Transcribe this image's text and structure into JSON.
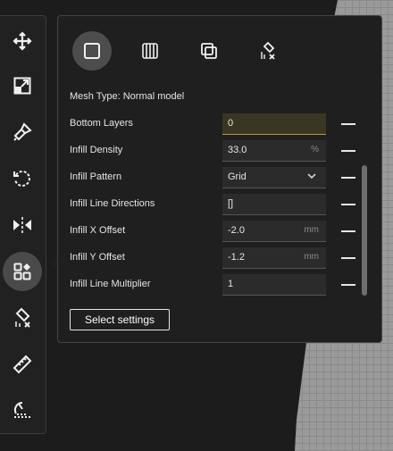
{
  "panel": {
    "mesh_type_label": "Mesh Type: Normal model",
    "mesh_modes": [
      {
        "icon": "normal-model-square-icon",
        "selected": true
      },
      {
        "icon": "support-blocker-lines-icon",
        "selected": false
      },
      {
        "icon": "overlap-squares-icon",
        "selected": false
      },
      {
        "icon": "infill-mesh-modify-icon",
        "selected": false
      }
    ],
    "settings": [
      {
        "label": "Bottom Layers",
        "value": "0",
        "unit": "",
        "type": "text",
        "highlighted": true
      },
      {
        "label": "Infill Density",
        "value": "33.0",
        "unit": "%",
        "type": "text",
        "highlighted": false
      },
      {
        "label": "Infill Pattern",
        "value": "Grid",
        "unit": "",
        "type": "dropdown",
        "highlighted": false
      },
      {
        "label": "Infill Line Directions",
        "value": "[]",
        "unit": "",
        "type": "text",
        "highlighted": false
      },
      {
        "label": "Infill X Offset",
        "value": "-2.0",
        "unit": "mm",
        "type": "text",
        "highlighted": false
      },
      {
        "label": "Infill Y Offset",
        "value": "-1.2",
        "unit": "mm",
        "type": "text",
        "highlighted": false
      },
      {
        "label": "Infill Line Multiplier",
        "value": "1",
        "unit": "",
        "type": "text",
        "highlighted": false
      }
    ],
    "select_settings_label": "Select settings"
  },
  "toolbar": {
    "tools": [
      {
        "icon": "move-icon",
        "active": false
      },
      {
        "icon": "scale-icon",
        "active": false
      },
      {
        "icon": "paint-brush-icon",
        "active": false
      },
      {
        "icon": "rotate-icon",
        "active": false
      },
      {
        "icon": "mirror-icon",
        "active": false
      },
      {
        "icon": "per-model-settings-icon",
        "active": true
      },
      {
        "icon": "support-blocker-icon",
        "active": false
      },
      {
        "icon": "measure-icon",
        "active": false
      },
      {
        "icon": "lay-flat-icon",
        "active": false
      }
    ]
  },
  "colors": {
    "panel_bg": "#1f1f1f",
    "field_bg": "#2b2b2b",
    "highlight_field": "#3a3623",
    "accent_border": "#b59a3c",
    "text": "#e6e6e6"
  }
}
